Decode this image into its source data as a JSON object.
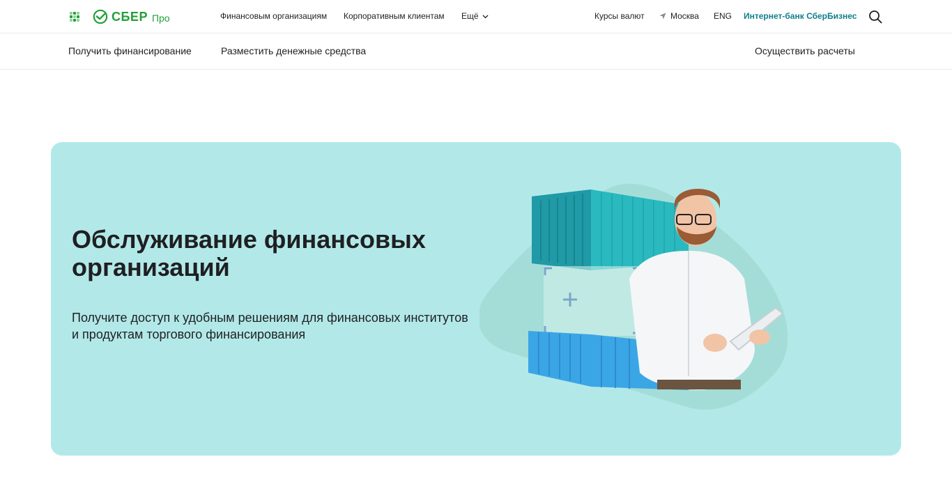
{
  "header": {
    "logo_text": "СБЕР",
    "logo_sub": "Про",
    "nav": {
      "financial_orgs": "Финансовым организациям",
      "corporate_clients": "Корпоративным клиентам",
      "more": "Ещё",
      "rates": "Курсы валют",
      "city": "Москва",
      "lang": "ENG",
      "bank": "Интернет-банк СберБизнес"
    },
    "colors": {
      "brand": "#21a038",
      "bank_link": "#107f8c"
    },
    "icons": [
      "apps-grid-icon",
      "sber-logo-icon",
      "chevron-down-icon",
      "location-arrow-icon",
      "search-icon"
    ]
  },
  "subnav": {
    "items": [
      {
        "label": "Получить финансирование"
      },
      {
        "label": "Разместить денежные средства"
      },
      {
        "label": "Осуществить расчеты"
      }
    ]
  },
  "hero": {
    "title": "Обслуживание финансовых организаций",
    "subtitle": "Получите доступ к удобным решениям для финансовых институтов и продуктам торгового финансирования",
    "background": "#b2e9e8"
  }
}
